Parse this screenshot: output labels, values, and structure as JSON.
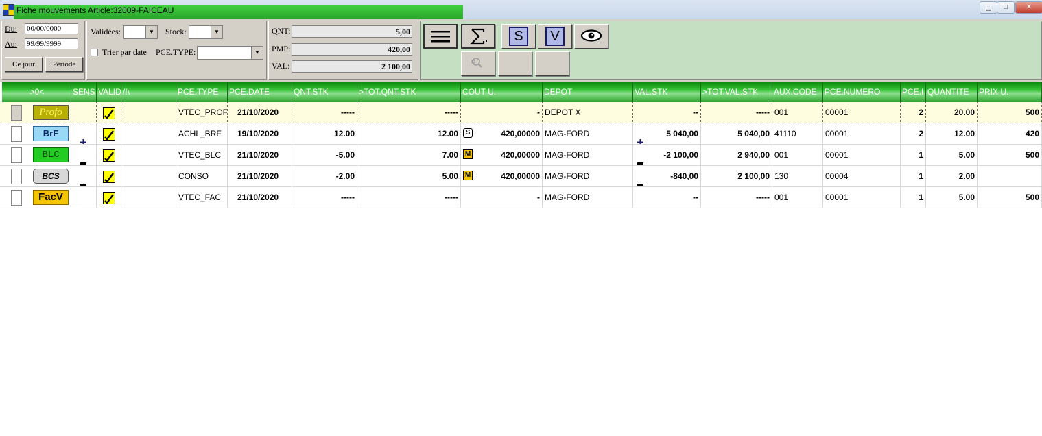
{
  "window": {
    "title": "Fiche mouvements Article:32009-FAICEAU",
    "minimize": "▁",
    "maximize": "□",
    "close": "✕"
  },
  "filters": {
    "du_label": "Du:",
    "du_value": "00/00/0000",
    "au_label": "Au:",
    "au_value": "99/99/9999",
    "ce_jour": "Ce jour",
    "periode": "Période",
    "validees_label": "Validées:",
    "stock_label": "Stock:",
    "trier_label": "Trier par date",
    "pce_type_label": "PCE.TYPE:"
  },
  "summary": {
    "qnt_label": "QNT:",
    "qnt_value": "5,00",
    "pmp_label": "PMP:",
    "pmp_value": "420,00",
    "val_label": "VAL:",
    "val_value": "2 100,00"
  },
  "toolbar": {
    "s_label": "S",
    "v_label": "V"
  },
  "grid": {
    "columns": [
      ">0<",
      "SENS",
      "VALID",
      "/!\\",
      "PCE.TYPE",
      "PCE.DATE",
      "QNT.STK",
      ">TOT.QNT.STK",
      "COUT U.",
      "DEPOT",
      "VAL.STK",
      ">TOT.VAL.STK",
      "AUX.CODE",
      "PCE.NUMERO",
      "PCE.I",
      "QUANTITE",
      "PRIX U."
    ],
    "rows": [
      {
        "badge": "Profo",
        "sens": "",
        "pce_type": "VTEC_PROF",
        "pce_date": "21/10/2020",
        "qnt_stk": "-----",
        "tot_qnt_stk": "-----",
        "cout_icon": "",
        "cout_u": "-",
        "depot": "DEPOT X",
        "val_sign": "",
        "val_stk": "--",
        "tot_val_stk": "-----",
        "aux_code": "001",
        "pce_numero": "00001",
        "pce_i": "2",
        "quantite": "20.00",
        "prix_u": "500"
      },
      {
        "badge": "BrF",
        "sens": "+",
        "pce_type": "ACHL_BRF",
        "pce_date": "19/10/2020",
        "qnt_stk": "12.00",
        "tot_qnt_stk": "12.00",
        "cout_icon": "S",
        "cout_u": "420,00000",
        "depot": "MAG-FORD",
        "val_sign": "+",
        "val_stk": "5 040,00",
        "tot_val_stk": "5 040,00",
        "aux_code": "41110",
        "pce_numero": "00001",
        "pce_i": "2",
        "quantite": "12.00",
        "prix_u": "420"
      },
      {
        "badge": "BLC",
        "sens": "-",
        "pce_type": "VTEC_BLC",
        "pce_date": "21/10/2020",
        "qnt_stk": "-5.00",
        "tot_qnt_stk": "7.00",
        "cout_icon": "M",
        "cout_u": "420,00000",
        "depot": "MAG-FORD",
        "val_sign": "-",
        "val_stk": "-2 100,00",
        "tot_val_stk": "2 940,00",
        "aux_code": "001",
        "pce_numero": "00001",
        "pce_i": "1",
        "quantite": "5.00",
        "prix_u": "500"
      },
      {
        "badge": "BCS",
        "sens": "-",
        "pce_type": "CONSO",
        "pce_date": "21/10/2020",
        "qnt_stk": "-2.00",
        "tot_qnt_stk": "5.00",
        "cout_icon": "M",
        "cout_u": "420,00000",
        "depot": "MAG-FORD",
        "val_sign": "-",
        "val_stk": "-840,00",
        "tot_val_stk": "2 100,00",
        "aux_code": "130",
        "pce_numero": "00004",
        "pce_i": "1",
        "quantite": "2.00",
        "prix_u": ""
      },
      {
        "badge": "FacV",
        "sens": "",
        "pce_type": "VTEC_FAC",
        "pce_date": "21/10/2020",
        "qnt_stk": "-----",
        "tot_qnt_stk": "-----",
        "cout_icon": "",
        "cout_u": "-",
        "depot": "MAG-FORD",
        "val_sign": "",
        "val_stk": "--",
        "tot_val_stk": "-----",
        "aux_code": "001",
        "pce_numero": "00001",
        "pce_i": "1",
        "quantite": "5.00",
        "prix_u": "500"
      }
    ]
  },
  "colors": {
    "header_green": "#2aa52a",
    "panel_green": "#c5dfc3",
    "selected_row": "#fffde0",
    "check_yellow": "#ffff00"
  }
}
